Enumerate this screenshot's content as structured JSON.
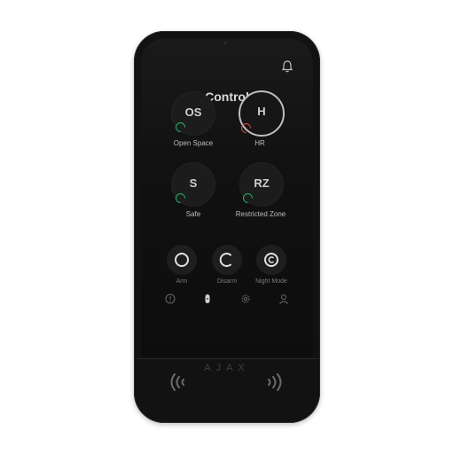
{
  "header": {
    "title": "Control",
    "bell_icon": "bell-icon"
  },
  "zones": [
    {
      "code": "OS",
      "label": "Open Space",
      "status": "disarmed",
      "status_color": "#27b36b"
    },
    {
      "code": "H",
      "label": "HR",
      "status": "armed",
      "status_color": "#d9534f"
    },
    {
      "code": "S",
      "label": "Safe",
      "status": "disarmed",
      "status_color": "#27b36b"
    },
    {
      "code": "RZ",
      "label": "Restricted Zone",
      "status": "disarmed",
      "status_color": "#27b36b"
    }
  ],
  "modes": [
    {
      "label": "Arm",
      "icon": "arm-icon"
    },
    {
      "label": "Disarm",
      "icon": "disarm-icon"
    },
    {
      "label": "Night Mode",
      "icon": "night-mode-icon"
    }
  ],
  "nav": [
    {
      "icon": "alert-icon"
    },
    {
      "icon": "keypad-icon"
    },
    {
      "icon": "settings-icon"
    },
    {
      "icon": "user-icon"
    }
  ],
  "brand": {
    "logo_text": "AJAX"
  },
  "nfc": {
    "icon": "nfc-icon"
  }
}
